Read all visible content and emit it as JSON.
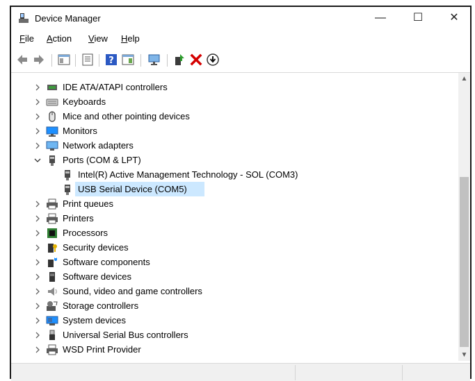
{
  "window": {
    "title": "Device Manager",
    "minimize_glyph": "—",
    "maximize_glyph": "☐",
    "close_glyph": "✕"
  },
  "menu": [
    {
      "key": "F",
      "rest": "ile"
    },
    {
      "key": "A",
      "rest": "ction"
    },
    {
      "key": "V",
      "rest": "iew"
    },
    {
      "key": "H",
      "rest": "elp"
    }
  ],
  "toolbar": [
    "back-icon",
    "forward-icon",
    "show-hide-console-tree-icon",
    "properties-icon",
    "help-icon",
    "action-pane-icon",
    "scan-hardware-icon",
    "update-driver-icon",
    "uninstall-icon",
    "disable-device-icon"
  ],
  "tree": [
    {
      "label": "IDE ATA/ATAPI controllers",
      "icon": "ide-controller-icon",
      "level": 0,
      "expanded": false
    },
    {
      "label": "Keyboards",
      "icon": "keyboard-icon",
      "level": 0,
      "expanded": false
    },
    {
      "label": "Mice and other pointing devices",
      "icon": "mouse-icon",
      "level": 0,
      "expanded": false
    },
    {
      "label": "Monitors",
      "icon": "monitor-icon",
      "level": 0,
      "expanded": false
    },
    {
      "label": "Network adapters",
      "icon": "network-adapter-icon",
      "level": 0,
      "expanded": false
    },
    {
      "label": "Ports (COM & LPT)",
      "icon": "port-icon",
      "level": 0,
      "expanded": true
    },
    {
      "label": "Intel(R) Active Management Technology - SOL (COM3)",
      "icon": "port-icon",
      "level": 1
    },
    {
      "label": "USB Serial Device (COM5)",
      "icon": "port-icon",
      "level": 1,
      "selected": true
    },
    {
      "label": "Print queues",
      "icon": "printer-icon",
      "level": 0,
      "expanded": false
    },
    {
      "label": "Printers",
      "icon": "printer-icon",
      "level": 0,
      "expanded": false
    },
    {
      "label": "Processors",
      "icon": "processor-icon",
      "level": 0,
      "expanded": false
    },
    {
      "label": "Security devices",
      "icon": "security-device-icon",
      "level": 0,
      "expanded": false
    },
    {
      "label": "Software components",
      "icon": "software-component-icon",
      "level": 0,
      "expanded": false
    },
    {
      "label": "Software devices",
      "icon": "software-device-icon",
      "level": 0,
      "expanded": false
    },
    {
      "label": "Sound, video and game controllers",
      "icon": "speaker-icon",
      "level": 0,
      "expanded": false
    },
    {
      "label": "Storage controllers",
      "icon": "storage-controller-icon",
      "level": 0,
      "expanded": false
    },
    {
      "label": "System devices",
      "icon": "system-device-icon",
      "level": 0,
      "expanded": false
    },
    {
      "label": "Universal Serial Bus controllers",
      "icon": "usb-icon",
      "level": 0,
      "expanded": false
    },
    {
      "label": "WSD Print Provider",
      "icon": "printer-icon",
      "level": 0,
      "expanded": false
    }
  ],
  "colors": {
    "selection": "#cce8ff",
    "accent": "#1e90ff",
    "delete": "#d40000"
  }
}
